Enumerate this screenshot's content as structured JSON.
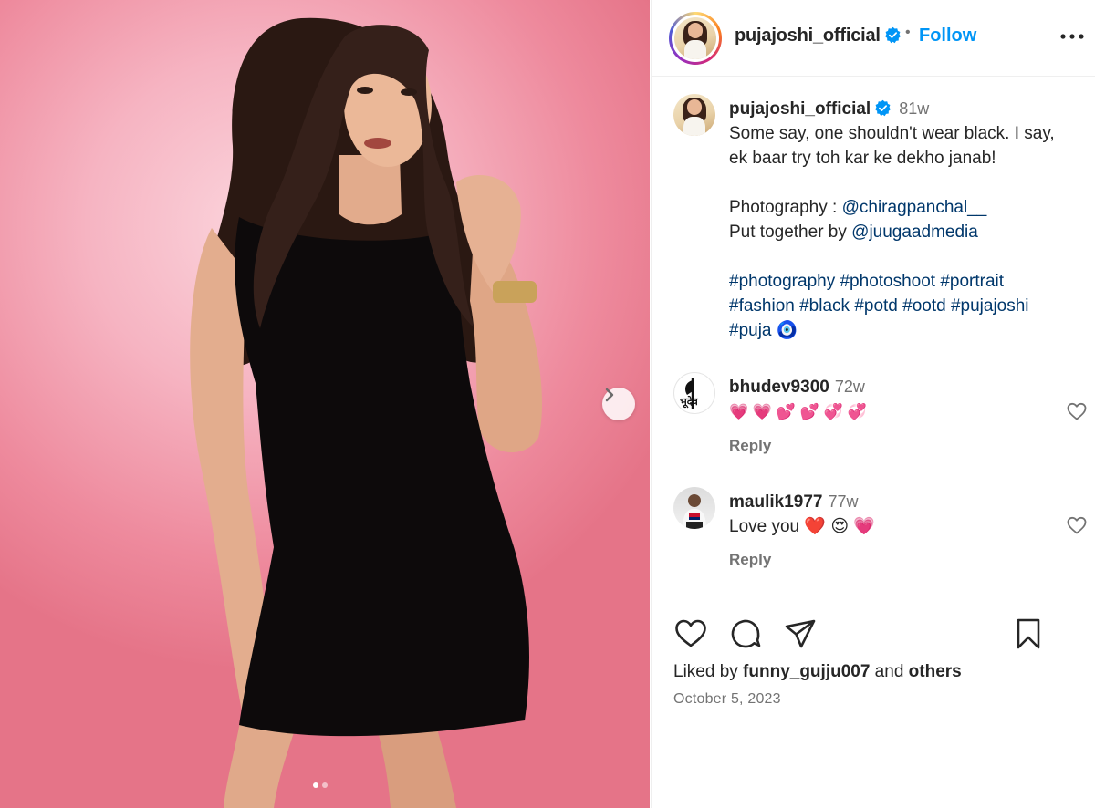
{
  "post": {
    "username": "pujajoshi_official",
    "follow_label": "Follow",
    "bullet": "•",
    "caption_time": "81w",
    "caption_lines": [
      "Some say, one shouldn't wear black. I say,",
      "ek baar try toh kar ke dekho janab!"
    ],
    "credits": {
      "photography_prefix": "Photography : ",
      "photography_handle": "@chiragpanchal__",
      "put_together_prefix": "Put together by ",
      "put_together_handle": "@juugaadmedia"
    },
    "hashtags_line1": "#photography #photoshoot #portrait",
    "hashtags_line2": "#fashion #black #potd #ootd #pujajoshi",
    "hashtags_line3": "#puja",
    "hashtag_emoji": "🧿"
  },
  "comments": [
    {
      "user": "bhudev9300",
      "time": "72w",
      "text": "💗 💗 💕 💕 💞 💞",
      "reply_label": "Reply",
      "avatar_text": "भूदेव"
    },
    {
      "user": "maulik1977",
      "time": "77w",
      "text": "Love you ❤️  😍  💗",
      "reply_label": "Reply"
    }
  ],
  "footer": {
    "liked_by_prefix": "Liked by ",
    "liked_by_user": "funny_gujju007",
    "liked_by_mid": " and ",
    "liked_by_others": "others",
    "date": "October 5, 2023"
  },
  "carousel": {
    "slide_count": 2,
    "active_index": 0
  },
  "colors": {
    "accent": "#0095f6",
    "link": "#00376b",
    "muted": "#737373",
    "verified": "#0095f6"
  }
}
